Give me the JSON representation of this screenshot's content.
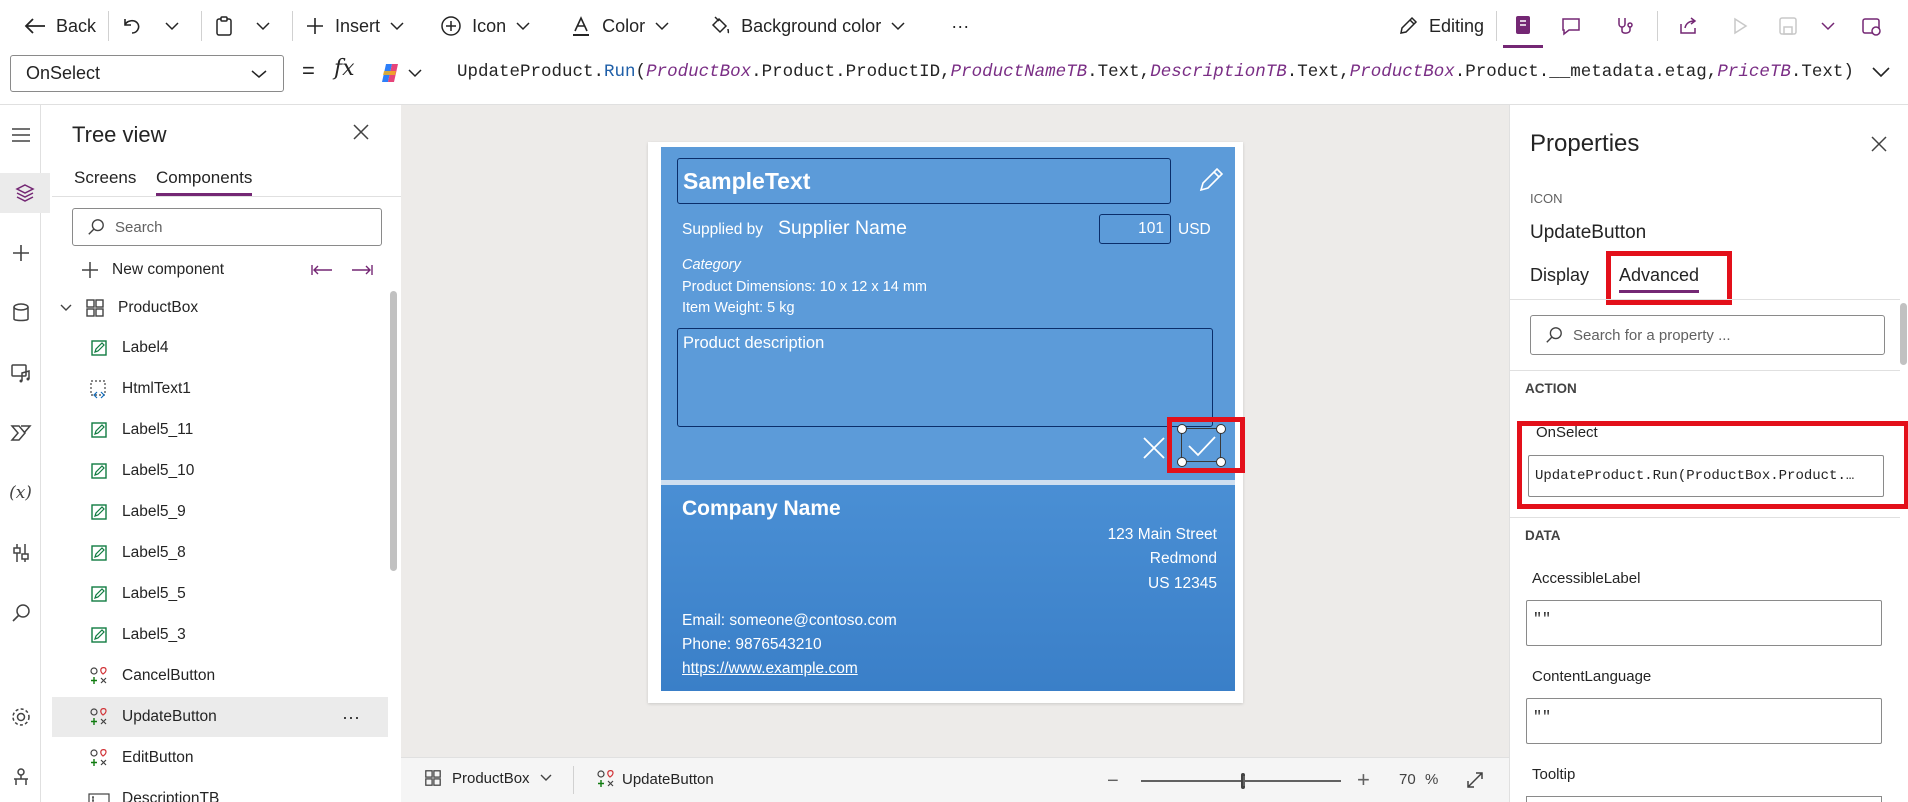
{
  "toolbar": {
    "back": "Back",
    "insert": "Insert",
    "icon": "Icon",
    "color": "Color",
    "background_color": "Background color",
    "more": "···",
    "editing": "Editing"
  },
  "formula": {
    "property": "OnSelect",
    "equals": "=",
    "fx": "fx",
    "parts": [
      {
        "t": "UpdateProduct.",
        "c": "fn"
      },
      {
        "t": "Run",
        "c": "run"
      },
      {
        "t": "(",
        "c": "fn"
      },
      {
        "t": "ProductBox",
        "c": "ctrl"
      },
      {
        "t": ".Product.ProductID,",
        "c": "fn"
      },
      {
        "t": "ProductNameTB",
        "c": "ctrl"
      },
      {
        "t": ".Text,",
        "c": "fn"
      },
      {
        "t": "DescriptionTB",
        "c": "ctrl"
      },
      {
        "t": ".Text,",
        "c": "fn"
      },
      {
        "t": "ProductBox",
        "c": "ctrl"
      },
      {
        "t": ".Product.__metadata.etag,",
        "c": "fn"
      },
      {
        "t": "PriceTB",
        "c": "ctrl"
      },
      {
        "t": ".Text)",
        "c": "fn"
      }
    ]
  },
  "tree": {
    "title": "Tree view",
    "tabs": [
      "Screens",
      "Components"
    ],
    "search_placeholder": "Search",
    "new_component": "New component",
    "root": "ProductBox",
    "items": [
      {
        "label": "Label4",
        "icon": "edit-icon"
      },
      {
        "label": "HtmlText1",
        "icon": "html-icon"
      },
      {
        "label": "Label5_11",
        "icon": "edit-icon"
      },
      {
        "label": "Label5_10",
        "icon": "edit-icon"
      },
      {
        "label": "Label5_9",
        "icon": "edit-icon"
      },
      {
        "label": "Label5_8",
        "icon": "edit-icon"
      },
      {
        "label": "Label5_5",
        "icon": "edit-icon"
      },
      {
        "label": "Label5_3",
        "icon": "edit-icon"
      },
      {
        "label": "CancelButton",
        "icon": "shapes-icon"
      },
      {
        "label": "UpdateButton",
        "icon": "shapes-icon"
      },
      {
        "label": "EditButton",
        "icon": "shapes-icon"
      },
      {
        "label": "DescriptionTB",
        "icon": "textinput-icon"
      }
    ]
  },
  "card": {
    "product_name": "SampleText",
    "supplied_by": "Supplied by",
    "supplier_name": "Supplier Name",
    "price": "101",
    "currency": "USD",
    "category": "Category",
    "dimensions": "Product Dimensions: 10 x 12 x 14 mm",
    "weight": "Item Weight: 5 kg",
    "description": "Product description",
    "company": "Company Name",
    "street": "123 Main Street",
    "city": "Redmond",
    "state": "US 12345",
    "email": "Email: someone@contoso.com",
    "phone": "Phone: 9876543210",
    "url": "https://www.example.com"
  },
  "status": {
    "crumb1": "ProductBox",
    "crumb2": "UpdateButton",
    "zoom": "70",
    "zoom_unit": "%"
  },
  "props": {
    "title": "Properties",
    "kind": "ICON",
    "name": "UpdateButton",
    "tabs": [
      "Display",
      "Advanced"
    ],
    "search_placeholder": "Search for a property ...",
    "section_action": "ACTION",
    "onselect_label": "OnSelect",
    "onselect_value": "UpdateProduct.Run(ProductBox.Product.…",
    "section_data": "DATA",
    "accessible_label": "AccessibleLabel",
    "accessible_value": "\"\"",
    "content_language": "ContentLanguage",
    "content_language_value": "\"\"",
    "tooltip": "Tooltip"
  },
  "colors": {
    "accent": "#742774",
    "highlight": "#e3101a",
    "card_top": "#5a9bd8",
    "card_bottom": "#3f84cc"
  }
}
